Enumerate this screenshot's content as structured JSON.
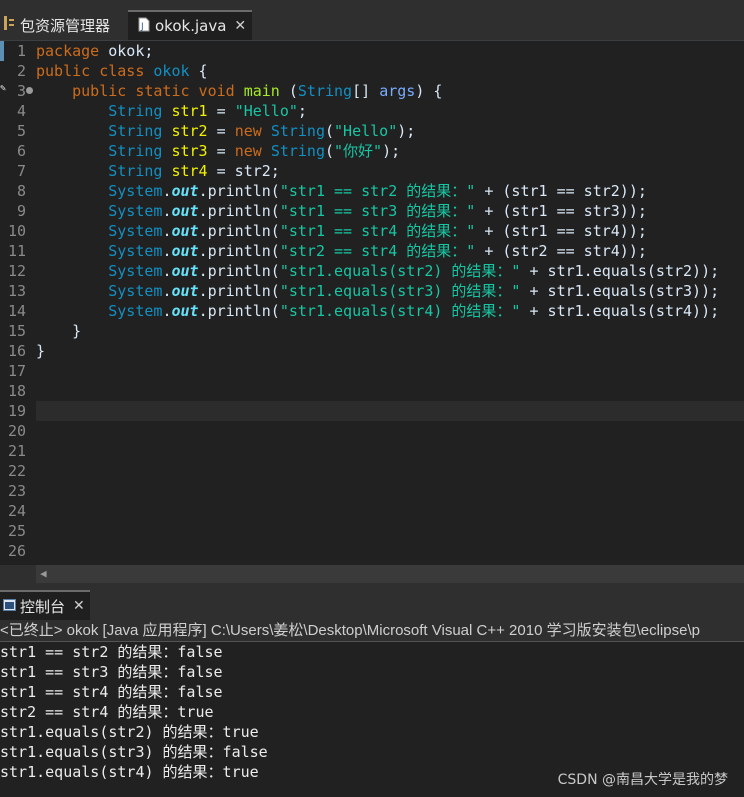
{
  "tabs": [
    {
      "label": "包资源管理器",
      "icon": "package-explorer-icon"
    },
    {
      "label": "okok.java",
      "icon": "java-file-icon",
      "active": true
    }
  ],
  "editor": {
    "line_numbers": [
      "1",
      "2",
      "3",
      "4",
      "5",
      "6",
      "7",
      "8",
      "9",
      "10",
      "11",
      "12",
      "13",
      "14",
      "15",
      "16",
      "17",
      "18",
      "19",
      "20",
      "21",
      "22",
      "23",
      "24",
      "25",
      "26"
    ]
  },
  "code": {
    "l1_kw": "package",
    "l1_rest": " okok;",
    "l2_kw": "public class",
    "l2_name": "okok",
    "l2_rest": " {",
    "l3_kw": "public static void",
    "l3_name": "main",
    "l3_a": " (",
    "l3_type": "String",
    "l3_b": "[] ",
    "l3_arg": "args",
    "l3_c": ") {",
    "str_type": "String",
    "l4_var": "str1",
    "l4_a": " = ",
    "l4_str": "\"Hello\"",
    "l4_b": ";",
    "l5_var": "str2",
    "l5_a": " = ",
    "l5_new": "new",
    "l5_type": "String",
    "l5_b": "(",
    "l5_str": "\"Hello\"",
    "l5_c": ");",
    "l6_var": "str3",
    "l6_a": " = ",
    "l6_new": "new",
    "l6_type": "String",
    "l6_b": "(",
    "l6_str": "\"你好\"",
    "l6_c": ");",
    "l7_var": "str4",
    "l7_a": " = str2;",
    "system": "System",
    "out": "out",
    "println": "println(",
    "l8_str": "\"str1 == str2 的结果：\"",
    "l8_rest": " + (str1 == str2));",
    "l9_str": "\"str1 == str3 的结果：\"",
    "l9_rest": " + (str1 == str3));",
    "l10_str": "\"str1 == str4 的结果：\"",
    "l10_rest": " + (str1 == str4));",
    "l11_str": "\"str2 == str4 的结果：\"",
    "l11_rest": " + (str2 == str4));",
    "l12_str": "\"str1.equals(str2) 的结果：\"",
    "l12_rest": " + str1.equals(str2));",
    "l13_str": "\"str1.equals(str3) 的结果：\"",
    "l13_rest": " + str1.equals(str3));",
    "l14_str": "\"str1.equals(str4) 的结果：\"",
    "l14_rest": " + str1.equals(str4));",
    "l15": "    }",
    "l16": "}"
  },
  "console": {
    "tab_label": "控制台",
    "header": "<已终止> okok [Java 应用程序] C:\\Users\\姜松\\Desktop\\Microsoft Visual C++ 2010 学习版安装包\\eclipse\\p",
    "output": [
      "str1 == str2 的结果：false",
      "str1 == str3 的结果：false",
      "str1 == str4 的结果：false",
      "str2 == str4 的结果：true",
      "str1.equals(str2) 的结果：true",
      "str1.equals(str3) 的结果：false",
      "str1.equals(str4) 的结果：true"
    ]
  },
  "watermark": "CSDN @南昌大学是我的梦"
}
